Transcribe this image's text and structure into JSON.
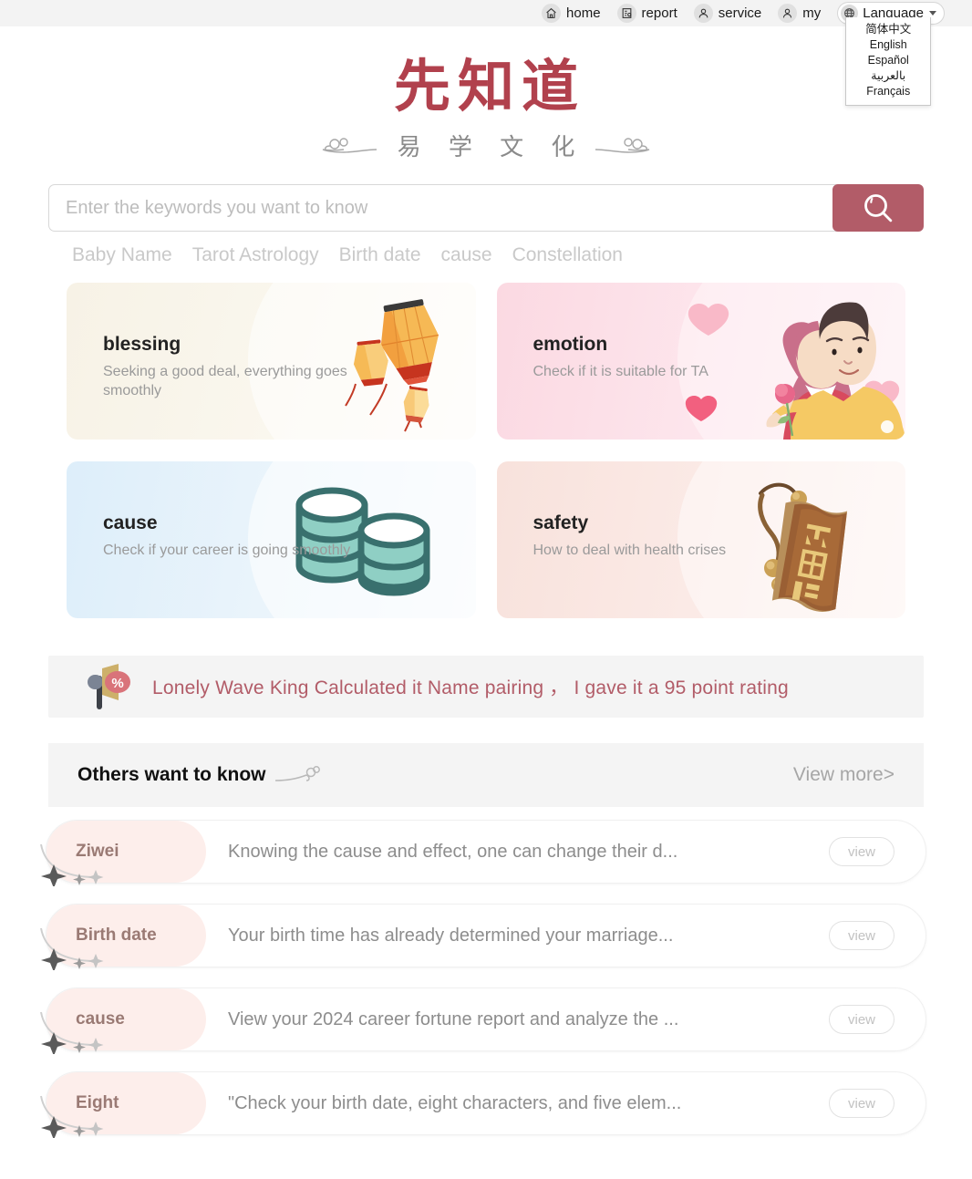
{
  "topnav": {
    "items": [
      {
        "label": "home",
        "icon": "home-icon"
      },
      {
        "label": "report",
        "icon": "report-icon"
      },
      {
        "label": "service",
        "icon": "service-icon"
      },
      {
        "label": "my",
        "icon": "user-icon"
      }
    ],
    "language": {
      "label": "Language",
      "icon": "globe-icon",
      "expanded": true,
      "options": [
        "简体中文",
        "English",
        "Español",
        "بالعربية",
        "Français"
      ]
    }
  },
  "logo": {
    "main": "先知道",
    "sub": "易 学 文 化",
    "main_color": "#b1414d",
    "sub_color": "#8a8a8a"
  },
  "search": {
    "value": "",
    "placeholder": "Enter the keywords you want to know",
    "button_icon": "search-icon",
    "button_color": "#b25c68",
    "tags": [
      "Baby Name",
      "Tarot Astrology",
      "Birth date",
      "cause",
      "Constellation"
    ]
  },
  "cards": [
    {
      "title": "blessing",
      "desc": "Seeking a good deal, everything goes smoothly",
      "art": "lantern-illustration",
      "theme": "c-blessing"
    },
    {
      "title": "emotion",
      "desc": "Check if it is suitable for TA",
      "art": "couple-illustration",
      "theme": "c-emotion"
    },
    {
      "title": "cause",
      "desc": "Check if your career is going smoothly",
      "art": "coins-illustration",
      "theme": "c-cause"
    },
    {
      "title": "safety",
      "desc": "How to deal with health crises",
      "art": "amulet-illustration",
      "theme": "c-safety"
    }
  ],
  "announcement": {
    "icon": "megaphone-percent-icon",
    "text": "Lonely Wave King Calculated it  Name pairing ，  I gave it a 95 point rating",
    "text_color": "#b25c68"
  },
  "others_section": {
    "title": "Others want to know",
    "decor_icon": "cloud-swirl-icon",
    "view_more": "View more",
    "view_more_chevron": ">"
  },
  "list": {
    "rows": [
      {
        "tag": "Ziwei",
        "text": "Knowing the cause and effect, one can change their d...",
        "action": "view"
      },
      {
        "tag": "Birth date",
        "text": "Your birth time has already determined your marriage...",
        "action": "view"
      },
      {
        "tag": "cause",
        "text": "View your 2024 career fortune report and analyze the ...",
        "action": "view"
      },
      {
        "tag": "Eight",
        "text": "\"Check your birth date, eight characters, and five elem...",
        "action": "view"
      }
    ]
  }
}
